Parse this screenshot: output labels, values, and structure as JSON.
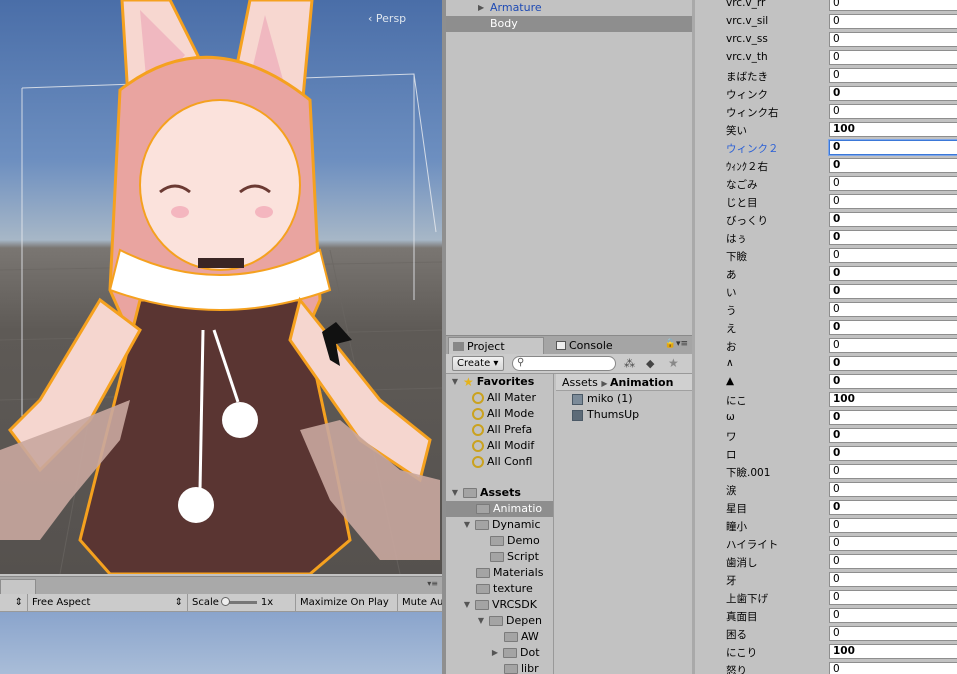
{
  "scene": {
    "persp_label": "Persp"
  },
  "hierarchy": {
    "items": [
      {
        "label": "Armature",
        "color": "#1f4bb4",
        "indent": 0
      },
      {
        "label": "Body",
        "color": "#ffffff",
        "indent": 1,
        "selected": true
      }
    ]
  },
  "game_view": {
    "toolbar": {
      "aspect": "Free Aspect",
      "scale_label": "Scale",
      "scale_value": "1x",
      "maximize": "Maximize On Play",
      "mute": "Mute Au"
    }
  },
  "project": {
    "tabs": [
      {
        "label": "Project",
        "active": true
      },
      {
        "label": "Console",
        "active": false
      }
    ],
    "create_label": "Create",
    "breadcrumb": {
      "root": "Assets",
      "current": "Animation"
    },
    "tree": [
      {
        "label": "Favorites",
        "type": "header",
        "bold": true
      },
      {
        "label": "All Mater",
        "type": "search"
      },
      {
        "label": "All Mode",
        "type": "search"
      },
      {
        "label": "All Prefa",
        "type": "search"
      },
      {
        "label": "All Modif",
        "type": "search"
      },
      {
        "label": "All Confl",
        "type": "search"
      },
      {
        "label": "Assets",
        "type": "header",
        "bold": true
      },
      {
        "label": "Animatio",
        "type": "folder",
        "selected": true
      },
      {
        "label": "Dynamic",
        "type": "folder"
      },
      {
        "label": "Demo",
        "type": "folder"
      },
      {
        "label": "Script",
        "type": "folder"
      },
      {
        "label": "Materials",
        "type": "folder"
      },
      {
        "label": "texture",
        "type": "folder"
      },
      {
        "label": "VRCSDK",
        "type": "folder"
      },
      {
        "label": "Depen",
        "type": "folder"
      },
      {
        "label": "AW",
        "type": "folder"
      },
      {
        "label": "Dot",
        "type": "folder"
      },
      {
        "label": "libr",
        "type": "folder"
      }
    ],
    "assets": [
      {
        "label": "miko (1)",
        "type": "controller"
      },
      {
        "label": "ThumsUp",
        "type": "animation"
      }
    ]
  },
  "blendshapes": [
    {
      "name": "vrc.v_rr",
      "value": "0"
    },
    {
      "name": "vrc.v_sil",
      "value": "0"
    },
    {
      "name": "vrc.v_ss",
      "value": "0"
    },
    {
      "name": "vrc.v_th",
      "value": "0"
    },
    {
      "name": "まばたき",
      "value": "0"
    },
    {
      "name": "ウィンク",
      "value": "0",
      "bold": true
    },
    {
      "name": "ウィンク右",
      "value": "0"
    },
    {
      "name": "笑い",
      "value": "100",
      "bold": true
    },
    {
      "name": "ウィンク２",
      "value": "0",
      "bold": true,
      "selected": true
    },
    {
      "name": "ｳｨﾝｸ２右",
      "value": "0",
      "bold": true
    },
    {
      "name": "なごみ",
      "value": "0"
    },
    {
      "name": "じと目",
      "value": "0"
    },
    {
      "name": "びっくり",
      "value": "0",
      "bold": true
    },
    {
      "name": "はぅ",
      "value": "0",
      "bold": true
    },
    {
      "name": "下瞼",
      "value": "0"
    },
    {
      "name": "あ",
      "value": "0",
      "bold": true
    },
    {
      "name": "い",
      "value": "0",
      "bold": true
    },
    {
      "name": "う",
      "value": "0"
    },
    {
      "name": "え",
      "value": "0",
      "bold": true
    },
    {
      "name": "お",
      "value": "0"
    },
    {
      "name": "∧",
      "value": "0",
      "bold": true
    },
    {
      "name": "▲",
      "value": "0",
      "bold": true
    },
    {
      "name": "にこ",
      "value": "100",
      "bold": true
    },
    {
      "name": "ω",
      "value": "0",
      "bold": true
    },
    {
      "name": "ワ",
      "value": "0",
      "bold": true
    },
    {
      "name": "ロ",
      "value": "0",
      "bold": true
    },
    {
      "name": "下瞼.001",
      "value": "0"
    },
    {
      "name": "涙",
      "value": "0"
    },
    {
      "name": "星目",
      "value": "0",
      "bold": true
    },
    {
      "name": "瞳小",
      "value": "0"
    },
    {
      "name": "ハイライト",
      "value": "0"
    },
    {
      "name": "歯消し",
      "value": "0"
    },
    {
      "name": "牙",
      "value": "0"
    },
    {
      "name": "上歯下げ",
      "value": "0"
    },
    {
      "name": "真面目",
      "value": "0"
    },
    {
      "name": "困る",
      "value": "0"
    },
    {
      "name": "にこり",
      "value": "100",
      "bold": true
    },
    {
      "name": "怒り",
      "value": "0"
    }
  ]
}
